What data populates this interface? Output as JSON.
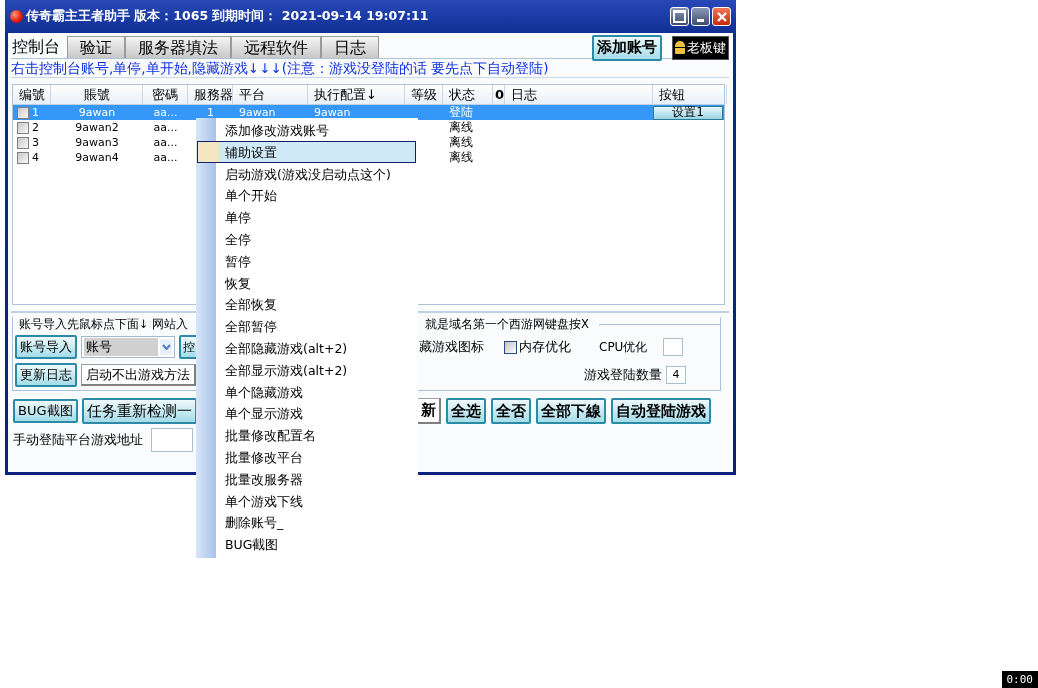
{
  "window": {
    "title": "传奇霸主王者助手 版本：1065 到期时间： 2021-09-14 19:07:11"
  },
  "tabs": [
    {
      "label": "控制台",
      "selected": true
    },
    {
      "label": "验证",
      "selected": false
    },
    {
      "label": "服务器填法",
      "selected": false
    },
    {
      "label": "远程软件",
      "selected": false
    },
    {
      "label": "日志",
      "selected": false
    }
  ],
  "toolbar_buttons": [
    {
      "label": "添加账号",
      "kind": "action"
    },
    {
      "label": "老板键",
      "kind": "boss"
    }
  ],
  "notice": "右击控制台账号,单停,单开始,隐藏游戏↓↓↓(注意：游戏没登陆的话 要先点下自动登陆)",
  "table": {
    "columns": [
      "编號",
      "賬號",
      "密碼",
      "服務器",
      "平台",
      "执行配置↓",
      "等级",
      "状态",
      "0",
      "日志",
      "按钮"
    ],
    "rows": [
      {
        "checked": false,
        "selected": true,
        "number": "1",
        "account": "9awan",
        "password": "aa...",
        "server": "1",
        "platform": "9awan",
        "config": "9awan",
        "status": "登陆",
        "button": "设置1"
      },
      {
        "checked": false,
        "selected": false,
        "number": "2",
        "account": "9awan2",
        "password": "aa...",
        "status": "离线"
      },
      {
        "checked": false,
        "selected": false,
        "number": "3",
        "account": "9awan3",
        "password": "aa...",
        "status": "离线"
      },
      {
        "checked": false,
        "selected": false,
        "number": "4",
        "account": "9awan4",
        "password": "aa...",
        "status": "离线"
      }
    ]
  },
  "import_panel": {
    "legend_left": "账号导入先鼠标点下面↓ 网站入",
    "legend_right": "就是域名第一个西游网键盘按X",
    "import_button": "账号导入",
    "account_select": {
      "value": "账号"
    },
    "partial_button": "控",
    "update_log_button": "更新日志",
    "launch_help_button": "启动不出游戏方法",
    "hide_icon_label": "藏游戏图标",
    "memory_opt": {
      "label": "内存优化",
      "checked": false
    },
    "cpu_opt": {
      "label": "CPU优化"
    },
    "login_count": {
      "label": "游戏登陆数量",
      "value": "4"
    }
  },
  "actions_left": [
    "BUG截图",
    "任务重新检测一"
  ],
  "actions_right": [
    {
      "label": "新",
      "kind": "plain"
    },
    {
      "label": "全选",
      "kind": "cyan"
    },
    {
      "label": "全否",
      "kind": "cyan"
    },
    {
      "label": "全部下線",
      "kind": "cyan"
    },
    {
      "label": "自动登陆游戏",
      "kind": "cyan"
    }
  ],
  "manual_login": {
    "label": "手动登陆平台游戏地址"
  },
  "context_menu": {
    "items": [
      {
        "label": "添加修改游戏账号",
        "selected": false
      },
      {
        "label": "辅助设置",
        "selected": true
      },
      {
        "label": "启动游戏(游戏没启动点这个)",
        "selected": false
      },
      {
        "label": "单个开始",
        "selected": false
      },
      {
        "label": "单停",
        "selected": false
      },
      {
        "label": "全停",
        "selected": false
      },
      {
        "label": "暂停",
        "selected": false
      },
      {
        "label": "恢复",
        "selected": false
      },
      {
        "label": "全部恢复",
        "selected": false
      },
      {
        "label": "全部暂停",
        "selected": false
      },
      {
        "label": "全部隐藏游戏(alt+2)",
        "selected": false
      },
      {
        "label": "全部显示游戏(alt+2)",
        "selected": false
      },
      {
        "label": "单个隐藏游戏",
        "selected": false
      },
      {
        "label": "单个显示游戏",
        "selected": false
      },
      {
        "label": "批量修改配置名",
        "selected": false
      },
      {
        "label": "批量修改平台",
        "selected": false
      },
      {
        "label": "批量改服务器",
        "selected": false
      },
      {
        "label": "单个游戏下线",
        "selected": false
      },
      {
        "label": "删除账号_",
        "selected": false
      },
      {
        "label": "BUG截图",
        "selected": false
      }
    ]
  },
  "clock": "0:00"
}
